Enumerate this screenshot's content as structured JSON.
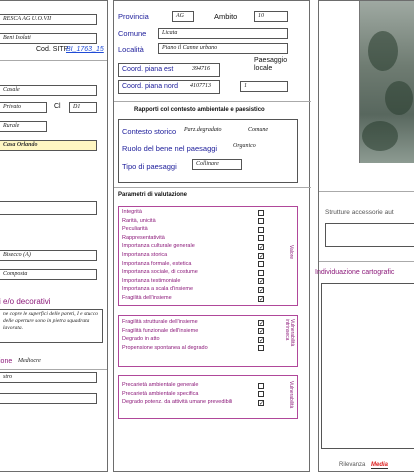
{
  "left": {
    "f0": "RESCA AG U.O.VII",
    "f1": "Beni Isolati",
    "sitp_label": "Cod. SITP",
    "sitp_value": "BI_1763_15",
    "f2": "Casale",
    "f3": "Privato",
    "cl_label": "Cl",
    "cl_value": "D1",
    "f4": "Rurale",
    "f5": "Casa Orlando",
    "f6": "Bisecco (A)",
    "f7": "Composta",
    "deco_title": "i e/o decorativi",
    "deco_text": "ne copre le superfici delle pareti, I e stucco delle aperture sono in pietra squadrata lavorata.",
    "cons_label": "ione",
    "cons_value": "Mediocre",
    "f8": "stro"
  },
  "mid": {
    "provincia_label": "Provincia",
    "provincia_value": "AG",
    "ambito_label": "Ambito",
    "ambito_value": "10",
    "comune_label": "Comune",
    "comune_value": "Licata",
    "localita_label": "Località",
    "localita_value": "Piano il Canne urbano",
    "paesaggio_label": "Paesaggio locale",
    "est_label": "Coord. piana est",
    "est_value": "394716",
    "paesaggio_value": "1",
    "nord_label": "Coord. piana nord",
    "nord_value": "4107713",
    "rapporti_title": "Rapporti col contesto ambientale e paesistico",
    "contesto_label": "Contesto storico",
    "contesto_value": "Parz.degradato",
    "contesto_extra": "Comune",
    "ruolo_label": "Ruolo del bene nel paesaggi",
    "ruolo_value": "Organico",
    "tipo_label": "Tipo di paesaggi",
    "tipo_value": "Collinare",
    "parametri_title": "Parametri di valutazione",
    "group1": [
      {
        "label": "Integrità",
        "check": ""
      },
      {
        "label": "Rarità, unicità",
        "check": ""
      },
      {
        "label": "Peculiarità",
        "check": ""
      },
      {
        "label": "Rappresentatività",
        "check": ""
      },
      {
        "label": "Importanza culturale generale",
        "check": "✓"
      },
      {
        "label": "Importanza storica",
        "check": "✓"
      },
      {
        "label": "Importanza formale, estetica",
        "check": ""
      },
      {
        "label": "Importanza sociale, di costume",
        "check": ""
      },
      {
        "label": "Importanza testimoniale",
        "check": "✓"
      },
      {
        "label": "Importanza a scala d'insieme",
        "check": "✓"
      },
      {
        "label": "Fragilità dell'insieme",
        "check": "✓"
      }
    ],
    "group1_side": "Valore",
    "group2": [
      {
        "label": "Fragilità strutturale dell'insieme",
        "check": "✓"
      },
      {
        "label": "Fragilità funzionale dell'insieme",
        "check": "✓"
      },
      {
        "label": "Degrado in atto",
        "check": "✓"
      },
      {
        "label": "Propensione spontanea al degrado",
        "check": ""
      }
    ],
    "group2_side": "Vulnerabilità intrinseca",
    "group3": [
      {
        "label": "Precarietà ambientale generale",
        "check": ""
      },
      {
        "label": "Precarietà ambientale specifica",
        "check": ""
      },
      {
        "label": "Degrado potenz. da attività umane prevedibili",
        "check": "✓"
      }
    ],
    "group3_side": "Vulnerabilità"
  },
  "right": {
    "strutture_label": "Strutture accessorie aut",
    "individuazione_label": "Individuazione cartografic",
    "rilevanza_label": "Rilevanza",
    "rilevanza_value": "Media"
  }
}
